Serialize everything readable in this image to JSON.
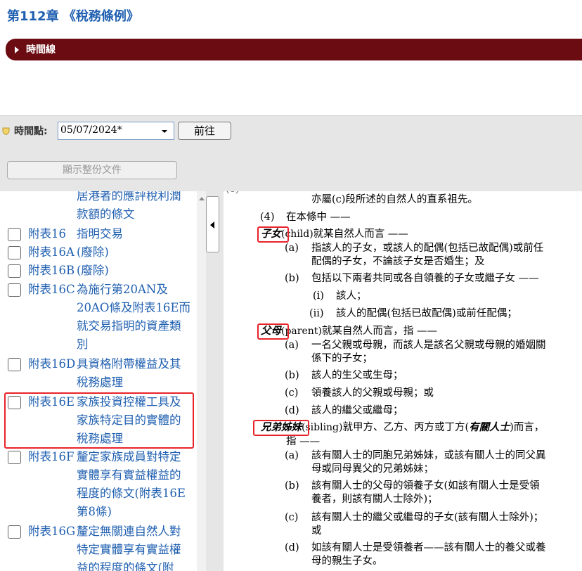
{
  "page_title": "第112章 《稅務條例》",
  "timeline_label": "時間線",
  "timepoint": {
    "label": "時間點:",
    "value": "05/07/2024*",
    "go_button": "前往"
  },
  "show_all_button": "顯示整份文件",
  "toc": [
    {
      "code": "",
      "title_lines": [
        "居港者的應評稅利潤",
        "款額的條文"
      ]
    },
    {
      "code": "附表16",
      "title_lines": [
        "指明交易"
      ]
    },
    {
      "code": "附表16A",
      "title_lines": [
        "(廢除)"
      ]
    },
    {
      "code": "附表16B",
      "title_lines": [
        "(廢除)"
      ]
    },
    {
      "code": "附表16C",
      "title_lines": [
        "為施行第20AN及",
        "20AO條及附表16E而",
        "就交易指明的資產類",
        "別"
      ]
    },
    {
      "code": "附表16D",
      "title_lines": [
        "具資格附帶權益及其",
        "稅務處理"
      ]
    },
    {
      "code": "附表16E",
      "title_lines": [
        "家族投資控權工具及",
        "家族特定目的實體的",
        "稅務處理"
      ]
    },
    {
      "code": "附表16F",
      "title_lines": [
        "釐定家族成員對特定",
        "實體享有實益權益的",
        "程度的條文(附表16E",
        "第8條)"
      ]
    },
    {
      "code": "附表16G",
      "title_lines": [
        "釐定無關連自然人對",
        "特定實體享有實益權",
        "益的程度的條文(附"
      ]
    }
  ],
  "content": {
    "top_partial": "亦屬(c)段所述的自然人的直系祖先。",
    "sub4_num": "(4)",
    "sub4_text": "在本條中 ——",
    "def_child": {
      "term": "子女",
      "en": "(child)",
      "rest": "就某自然人而言 ——",
      "items": [
        {
          "num": "(a)",
          "lines": [
            "指該人的子女，或該人的配偶(包括已故配偶)或前任",
            "配偶的子女，不論該子女是否婚生；及"
          ]
        },
        {
          "num": "(b)",
          "lines": [
            "包括以下兩者共同或各自領養的子女或繼子女 ——"
          ]
        }
      ],
      "subitems": [
        {
          "num": "(i)",
          "text": "該人；"
        },
        {
          "num": "(ii)",
          "text": "該人的配偶(包括已故配偶)或前任配偶；"
        }
      ]
    },
    "def_parent": {
      "term": "父母",
      "en": "(parent)",
      "rest": "就某自然人而言，指 ——",
      "items": [
        {
          "num": "(a)",
          "lines": [
            "一名父親或母親，而該人是該名父親或母親的婚姻關",
            "係下的子女；"
          ]
        },
        {
          "num": "(b)",
          "lines": [
            "該人的生父或生母；"
          ]
        },
        {
          "num": "(c)",
          "lines": [
            "領養該人的父親或母親；或"
          ]
        },
        {
          "num": "(d)",
          "lines": [
            "該人的繼父或繼母；"
          ]
        }
      ]
    },
    "def_sibling": {
      "term": "兄弟姊妹",
      "en": "(sibling)",
      "rest_pre": "就甲方、乙方、丙方或丁方(",
      "rest_term": "有關人士",
      "rest_post": ")而言，",
      "line2": "指 ——",
      "items": [
        {
          "num": "(a)",
          "lines": [
            "該有關人士的同胞兄弟姊妹，或該有關人士的同父異",
            "母或同母異父的兄弟姊妹；"
          ]
        },
        {
          "num": "(b)",
          "lines": [
            "該有關人士的父母的領養子女(如該有關人士是受領",
            "養者，則該有關人士除外)；"
          ]
        },
        {
          "num": "(c)",
          "lines": [
            "該有關人士的繼父或繼母的子女(該有關人士除外)；",
            "或"
          ]
        },
        {
          "num": "(d)",
          "lines": [
            "如該有關人士是受領養者——該有關人士的養父或養",
            "母的親生子女。"
          ]
        }
      ]
    }
  }
}
